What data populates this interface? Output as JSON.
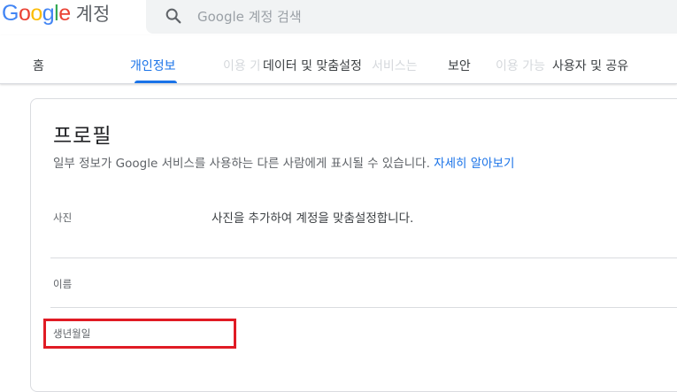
{
  "header": {
    "logo_text": "Google",
    "logo_suffix": "계정",
    "logo_colors": [
      "#4285F4",
      "#EA4335",
      "#FBBC05",
      "#4285F4",
      "#34A853",
      "#EA4335"
    ],
    "search_placeholder": "Google 계정 검색"
  },
  "tabs": [
    {
      "label": "홈",
      "active": false
    },
    {
      "label": "개인정보",
      "active": true
    },
    {
      "label": "데이터 및 맞춤설정",
      "active": false
    },
    {
      "label": "보안",
      "active": false
    },
    {
      "label": "사용자 및 공유",
      "active": false
    }
  ],
  "tab_ghosts": [
    "이용 가능",
    "서비스는",
    "이용 가능"
  ],
  "profile": {
    "title": "프로필",
    "description": "일부 정보가 Google 서비스를 사용하는 다른 사람에게 표시될 수 있습니다.",
    "learn_more": "자세히 알아보기",
    "rows": [
      {
        "label": "사진",
        "value": "사진을 추가하여 계정을 맞춤설정합니다."
      },
      {
        "label": "이름",
        "value": ""
      },
      {
        "label": "생년월일",
        "value": ""
      }
    ]
  },
  "colors": {
    "accent": "#1a73e8",
    "highlight": "#e01b24"
  }
}
